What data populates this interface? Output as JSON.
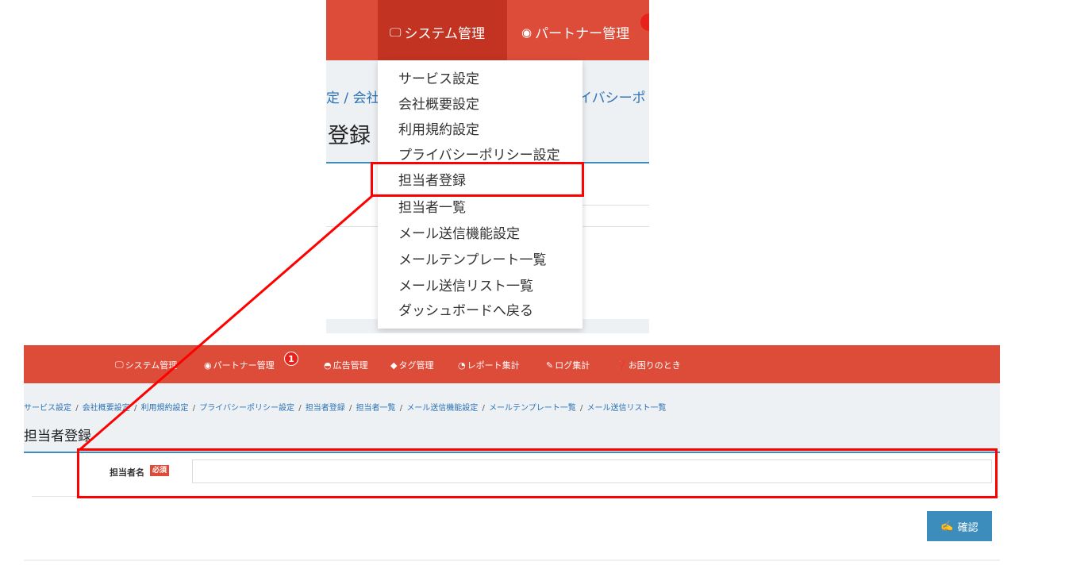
{
  "zoom": {
    "tabs": [
      {
        "label": "システム管理",
        "icon": "monitor-icon"
      },
      {
        "label": "パートナー管理",
        "icon": "eye-icon"
      }
    ],
    "breadcrumb_left": "定 / 会社",
    "breadcrumb_right": "イバシーポ",
    "title_partial": "登録",
    "dropdown_items": [
      "サービス設定",
      "会社概要設定",
      "利用規約設定",
      "プライバシーポリシー設定",
      "担当者登録",
      "担当者一覧",
      "メール送信機能設定",
      "メールテンプレート一覧",
      "メール送信リスト一覧",
      "ダッシュボードへ戻る"
    ],
    "highlighted_item": "担当者登録"
  },
  "nav": {
    "items": [
      {
        "label": "システム管理",
        "icon": "monitor-icon"
      },
      {
        "label": "パートナー管理",
        "icon": "eye-icon"
      },
      {
        "label": "広告管理",
        "icon": "dashboard-icon"
      },
      {
        "label": "タグ管理",
        "icon": "tag-icon"
      },
      {
        "label": "レポート集計",
        "icon": "pie-chart-icon"
      },
      {
        "label": "ログ集計",
        "icon": "pencil-icon"
      },
      {
        "label": "お困りのとき",
        "icon": "question-circle-icon"
      }
    ],
    "badge_count": "1"
  },
  "breadcrumb": [
    "サービス設定",
    "会社概要設定",
    "利用規約設定",
    "プライバシーポリシー設定",
    "担当者登録",
    "担当者一覧",
    "メール送信機能設定",
    "メールテンプレート一覧",
    "メール送信リスト一覧"
  ],
  "breadcrumb_separator": "/",
  "page_title": "担当者登録",
  "form": {
    "field_label": "担当者名",
    "required_badge": "必須",
    "input_value": "",
    "input_placeholder": ""
  },
  "confirm_button": {
    "label": "確認",
    "icon": "edit-icon"
  },
  "colors": {
    "navbar": "#dd4b39",
    "active_tab": "#c23321",
    "link": "#2c72b5",
    "primary_button": "#3c8dbc",
    "highlight": "#ff0000"
  }
}
